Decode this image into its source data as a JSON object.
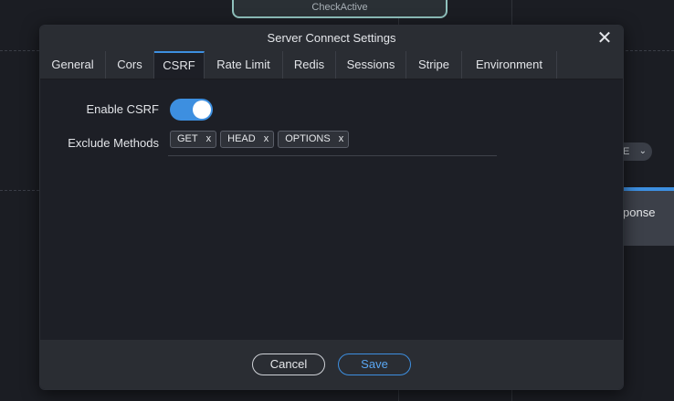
{
  "background": {
    "top_node_label": "CheckActive",
    "pill_label": "E",
    "right_node_label": "ponse"
  },
  "dialog": {
    "title": "Server Connect Settings",
    "tabs": [
      {
        "label": "General",
        "active": false
      },
      {
        "label": "Cors",
        "active": false
      },
      {
        "label": "CSRF",
        "active": true
      },
      {
        "label": "Rate Limit",
        "active": false
      },
      {
        "label": "Redis",
        "active": false
      },
      {
        "label": "Sessions",
        "active": false
      },
      {
        "label": "Stripe",
        "active": false
      },
      {
        "label": "Environment",
        "active": false
      }
    ],
    "enable_csrf": {
      "label": "Enable CSRF",
      "value": true
    },
    "exclude_methods": {
      "label": "Exclude Methods",
      "tags": [
        "GET",
        "HEAD",
        "OPTIONS"
      ],
      "remove_glyph": "x"
    },
    "footer": {
      "cancel_label": "Cancel",
      "save_label": "Save"
    }
  },
  "colors": {
    "accent": "#3d8fe0",
    "dialog_bg": "#1d1f26",
    "bar_bg": "#2a2d33"
  }
}
